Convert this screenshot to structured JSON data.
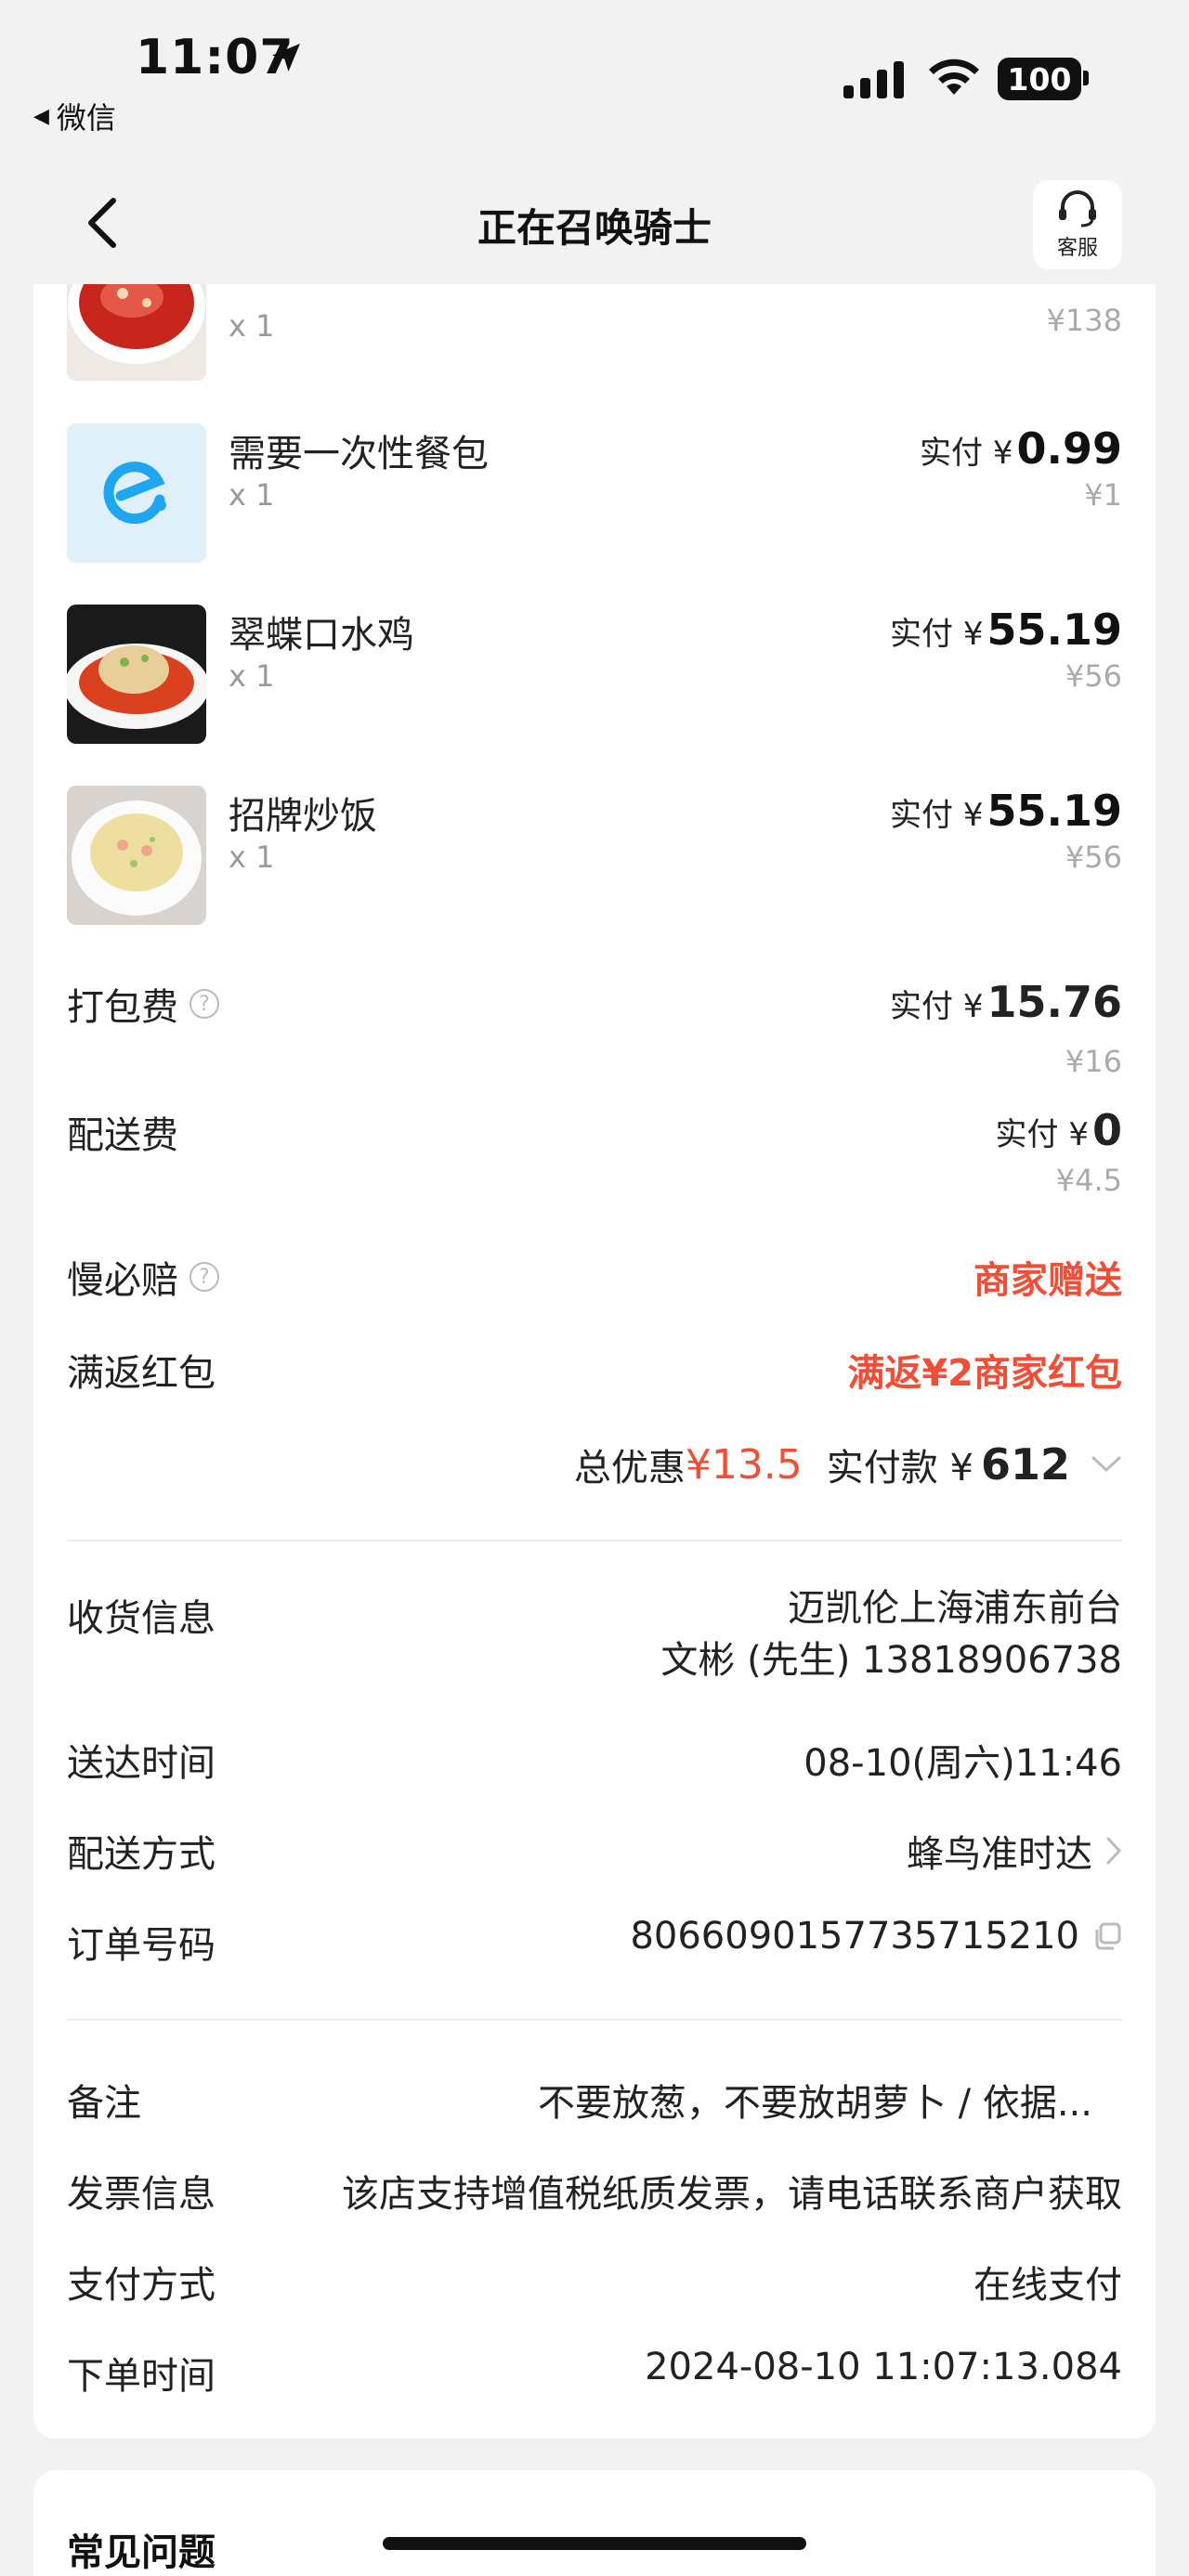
{
  "status": {
    "time": "11:07",
    "back_app": "微信",
    "battery": "100"
  },
  "nav": {
    "title": "正在召唤骑士",
    "service_label": "客服"
  },
  "items": [
    {
      "name": "",
      "qty": "x 1",
      "orig": "¥138"
    },
    {
      "name": "需要一次性餐包",
      "qty": "x 1",
      "pay_label": "实付 ¥",
      "pay": "0.99",
      "orig": "¥1"
    },
    {
      "name": "翠蝶口水鸡",
      "qty": "x 1",
      "pay_label": "实付 ¥",
      "pay": "55.19",
      "orig": "¥56"
    },
    {
      "name": "招牌炒饭",
      "qty": "x 1",
      "pay_label": "实付 ¥",
      "pay": "55.19",
      "orig": "¥56"
    }
  ],
  "fees": {
    "packing": {
      "label": "打包费",
      "pay_label": "实付 ¥",
      "pay": "15.76",
      "orig": "¥16"
    },
    "delivery": {
      "label": "配送费",
      "pay_label": "实付 ¥",
      "pay": "0",
      "orig": "¥4.5"
    },
    "slow_comp": {
      "label": "慢必赔",
      "value": "商家赠送"
    },
    "red_packet": {
      "label": "满返红包",
      "value": "满返¥2商家红包"
    }
  },
  "summary": {
    "discount_label": "总优惠",
    "discount": "¥13.5",
    "total_label": "实付款 ¥",
    "total": "612"
  },
  "info": {
    "receiver": {
      "label": "收货信息",
      "line1": "迈凯伦上海浦东前台",
      "line2": "文彬 (先生) 13818906738"
    },
    "arrival": {
      "label": "送达时间",
      "value": "08-10(周六)11:46"
    },
    "delivery_method": {
      "label": "配送方式",
      "value": "蜂鸟准时达"
    },
    "order_no": {
      "label": "订单号码",
      "value": "8066090157735715210"
    }
  },
  "extra": {
    "note": {
      "label": "备注",
      "value": "不要放葱，不要放胡萝卜 / 依据..."
    },
    "invoice": {
      "label": "发票信息",
      "value": "该店支持增值税纸质发票，请电话联系商户获取"
    },
    "payment": {
      "label": "支付方式",
      "value": "在线支付"
    },
    "order_time": {
      "label": "下单时间",
      "value": "2024-08-10 11:07:13.084"
    }
  },
  "faq": {
    "title": "常见问题"
  },
  "colors": {
    "accent_red": "#f04e37",
    "eleme_blue": "#1ea7f0"
  }
}
